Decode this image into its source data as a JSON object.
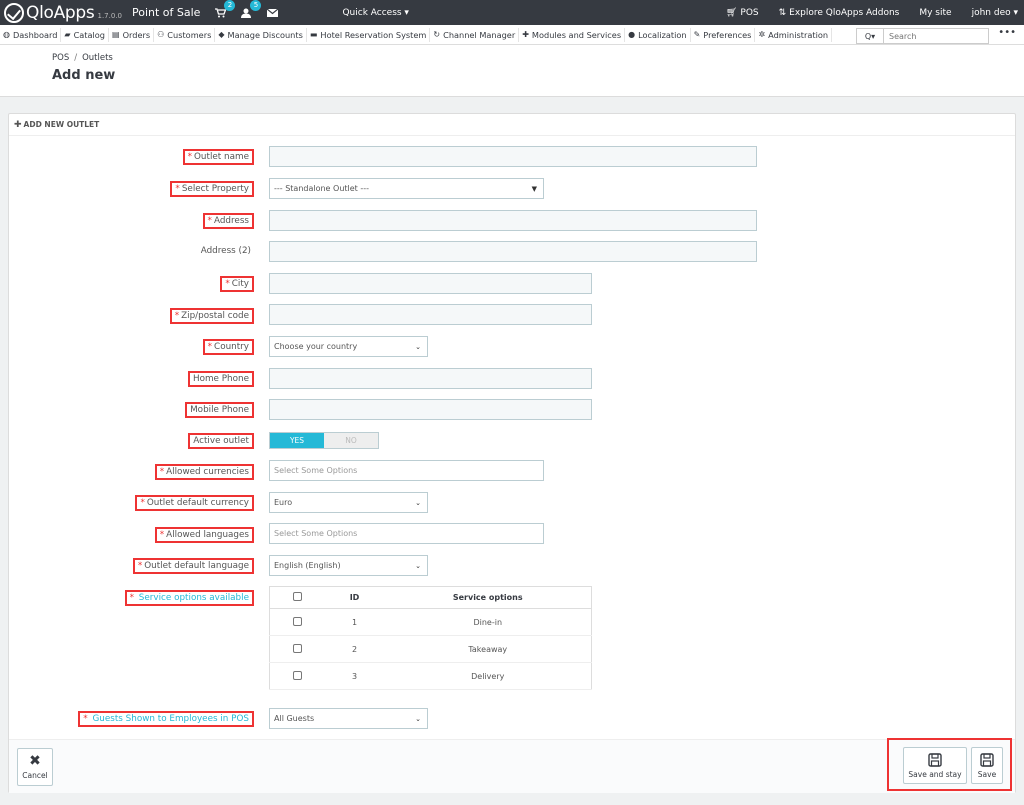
{
  "topbar": {
    "logo": "QloApps",
    "version": "1.7.0.0",
    "app_name": "Point of Sale",
    "cart_badge": "2",
    "user_badge": "5",
    "quick_access": "Quick Access ▾",
    "pos_link": "POS",
    "explore": "Explore QloApps Addons",
    "my_site": "My site",
    "user": "john deo ▾"
  },
  "nav": {
    "items": [
      {
        "icon": "dashboard-icon",
        "label": "Dashboard"
      },
      {
        "icon": "book-icon",
        "label": "Catalog"
      },
      {
        "icon": "orders-icon",
        "label": "Orders"
      },
      {
        "icon": "customers-icon",
        "label": "Customers"
      },
      {
        "icon": "tag-icon",
        "label": "Manage Discounts"
      },
      {
        "icon": "bed-icon",
        "label": "Hotel Reservation System"
      },
      {
        "icon": "refresh-icon",
        "label": "Channel Manager"
      },
      {
        "icon": "puzzle-icon",
        "label": "Modules and Services"
      },
      {
        "icon": "globe-icon",
        "label": "Localization"
      },
      {
        "icon": "wrench-icon",
        "label": "Preferences"
      },
      {
        "icon": "cog-icon",
        "label": "Administration"
      }
    ],
    "search_placeholder": "Search",
    "search_icon": "Q▾"
  },
  "header": {
    "breadcrumb": [
      "POS",
      "Outlets"
    ],
    "title": "Add new"
  },
  "panel": {
    "heading": "ADD NEW OUTLET",
    "fields": {
      "outlet_name": {
        "label": "Outlet name",
        "value": ""
      },
      "property": {
        "label": "Select Property",
        "value": "--- Standalone Outlet ---"
      },
      "address": {
        "label": "Address",
        "value": ""
      },
      "address2": {
        "label": "Address (2)",
        "value": ""
      },
      "city": {
        "label": "City",
        "value": ""
      },
      "zip": {
        "label": "Zip/postal code",
        "value": ""
      },
      "country": {
        "label": "Country",
        "value": "Choose your country"
      },
      "home_phone": {
        "label": "Home Phone",
        "value": ""
      },
      "mobile_phone": {
        "label": "Mobile Phone",
        "value": ""
      },
      "active": {
        "label": "Active outlet",
        "yes": "YES",
        "no": "NO",
        "value": "YES"
      },
      "allowed_currencies": {
        "label": "Allowed currencies",
        "placeholder": "Select Some Options"
      },
      "default_currency": {
        "label": "Outlet default currency",
        "value": "Euro"
      },
      "allowed_languages": {
        "label": "Allowed languages",
        "placeholder": "Select Some Options"
      },
      "default_language": {
        "label": "Outlet default language",
        "value": "English (English)"
      },
      "service_options": {
        "label": "Service options available"
      },
      "guests_shown": {
        "label": "Guests Shown to Employees in POS",
        "value": "All Guests"
      }
    },
    "service_table": {
      "headers": [
        "ID",
        "Service options"
      ],
      "rows": [
        {
          "id": "1",
          "name": "Dine-in"
        },
        {
          "id": "2",
          "name": "Takeaway"
        },
        {
          "id": "3",
          "name": "Delivery"
        }
      ]
    }
  },
  "footer": {
    "cancel": "Cancel",
    "save_and_stay": "Save and stay",
    "save": "Save"
  },
  "colors": {
    "accent": "#25b9d7",
    "topbar": "#363a41",
    "highlight": "#ee3333"
  }
}
